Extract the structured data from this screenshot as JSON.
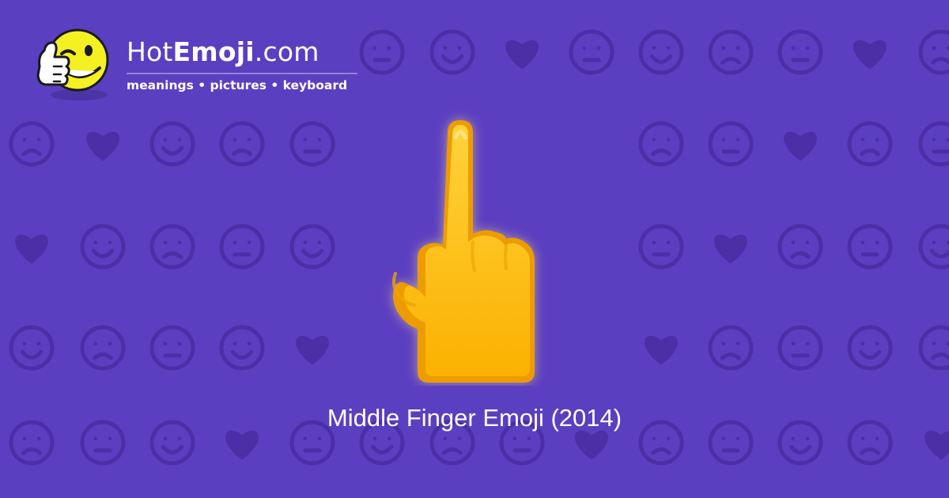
{
  "site": {
    "name_regular": "Hot",
    "name_bold": "Emoji",
    "name_suffix": ".com",
    "tagline": "meanings • pictures • keyboard"
  },
  "hero": {
    "emoji_icon": "middle-finger-icon",
    "caption": "Middle Finger Emoji (2014)"
  },
  "colors": {
    "background": "#5b3fc1",
    "pattern": "#4a2fa6",
    "hand": "#fcc21b",
    "logo_face": "#f5f022"
  }
}
